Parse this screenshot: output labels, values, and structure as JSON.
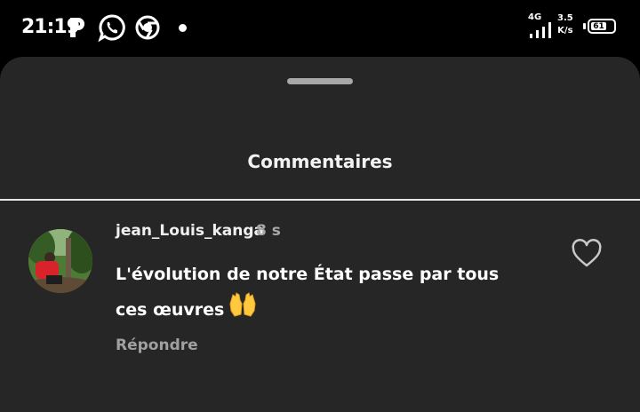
{
  "status_bar": {
    "time": "21:19",
    "network": "4G",
    "speed_value": "3.5",
    "speed_unit": "K/s",
    "battery_level": "61",
    "icons": [
      "parking-app-icon",
      "whatsapp-icon",
      "chrome-icon",
      "notification-dot-icon",
      "signal-icon",
      "battery-icon"
    ]
  },
  "sheet": {
    "title": "Commentaires"
  },
  "comment": {
    "username": "jean_Louis_kanga",
    "time": "8 s",
    "text": "L'évolution de notre État passe par tous ces œuvres",
    "emoji": "raising-hands-emoji",
    "reply_label": "Répondre",
    "like_icon": "heart-outline-icon"
  }
}
